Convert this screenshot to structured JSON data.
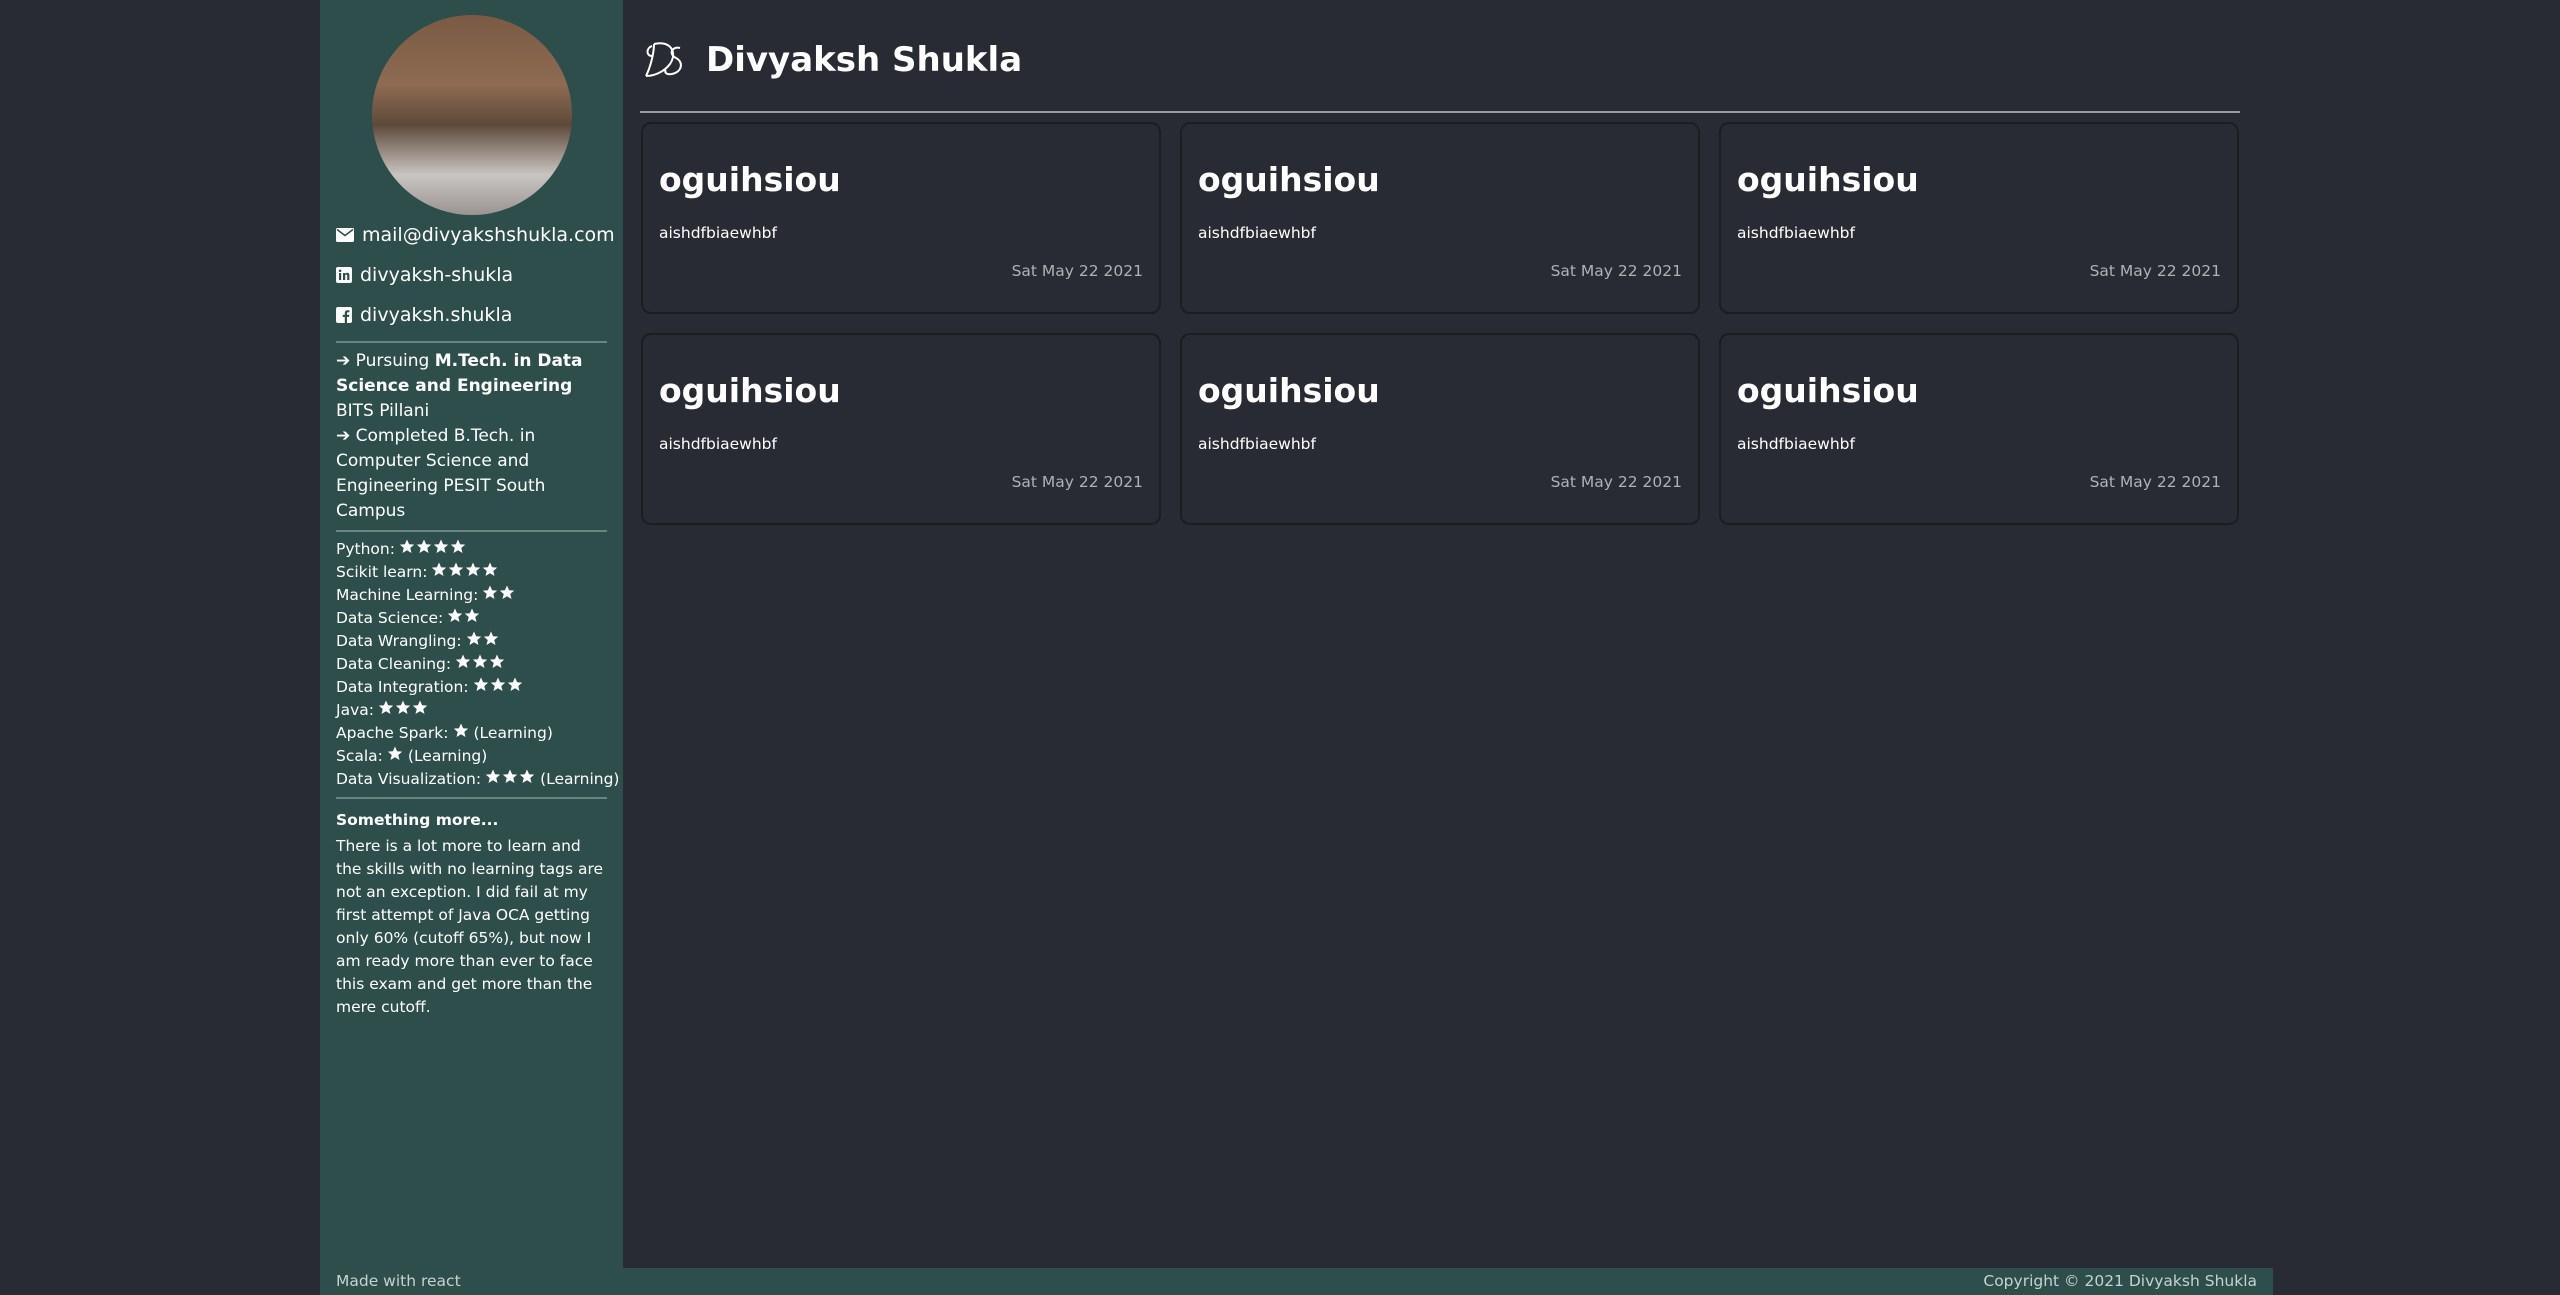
{
  "sidebar": {
    "contacts": [
      {
        "icon": "envelope-icon",
        "text": "mail@divyakshshukla.com"
      },
      {
        "icon": "linkedin-icon",
        "text": "divyaksh-shukla"
      },
      {
        "icon": "facebook-icon",
        "text": "divyaksh.shukla"
      }
    ],
    "education": [
      {
        "prefix": "Pursuing",
        "bold": "M.Tech. in Data Science and Engineering",
        "suffix": "BITS Pillani"
      },
      {
        "prefix": "Completed B.Tech. in Computer Science and Engineering PESIT South Campus",
        "bold": "",
        "suffix": ""
      }
    ],
    "skills": [
      {
        "name": "Python:",
        "stars": 4,
        "note": ""
      },
      {
        "name": "Scikit learn:",
        "stars": 4,
        "note": ""
      },
      {
        "name": "Machine Learning:",
        "stars": 2,
        "note": ""
      },
      {
        "name": "Data Science:",
        "stars": 2,
        "note": ""
      },
      {
        "name": "Data Wrangling:",
        "stars": 2,
        "note": ""
      },
      {
        "name": "Data Cleaning:",
        "stars": 3,
        "note": ""
      },
      {
        "name": "Data Integration:",
        "stars": 3,
        "note": ""
      },
      {
        "name": "Java:",
        "stars": 3,
        "note": ""
      },
      {
        "name": "Apache Spark:",
        "stars": 1,
        "note": "(Learning)"
      },
      {
        "name": "Scala:",
        "stars": 1,
        "note": "(Learning)"
      },
      {
        "name": "Data Visualization:",
        "stars": 3,
        "note": "(Learning)"
      }
    ],
    "more_title": "Something more...",
    "more_text": "There is a lot more to learn and the skills with no learning tags are not an exception. I did fail at my first attempt of Java OCA getting only 60% (cutoff 65%), but now I am ready more than ever to face this exam and get more than the mere cutoff."
  },
  "header": {
    "title": "Divyaksh Shukla"
  },
  "cards": [
    {
      "title": "oguihsiou",
      "text": "aishdfbiaewhbf",
      "date": "Sat May 22 2021"
    },
    {
      "title": "oguihsiou",
      "text": "aishdfbiaewhbf",
      "date": "Sat May 22 2021"
    },
    {
      "title": "oguihsiou",
      "text": "aishdfbiaewhbf",
      "date": "Sat May 22 2021"
    },
    {
      "title": "oguihsiou",
      "text": "aishdfbiaewhbf",
      "date": "Sat May 22 2021"
    },
    {
      "title": "oguihsiou",
      "text": "aishdfbiaewhbf",
      "date": "Sat May 22 2021"
    },
    {
      "title": "oguihsiou",
      "text": "aishdfbiaewhbf",
      "date": "Sat May 22 2021"
    }
  ],
  "footer": {
    "left": "Made with react",
    "right": "Copyright © 2021 Divyaksh Shukla"
  },
  "colors": {
    "background": "#282b33",
    "sidebar": "#2e4e4b",
    "text": "#ffffff",
    "muted": "#aeb1b6"
  }
}
